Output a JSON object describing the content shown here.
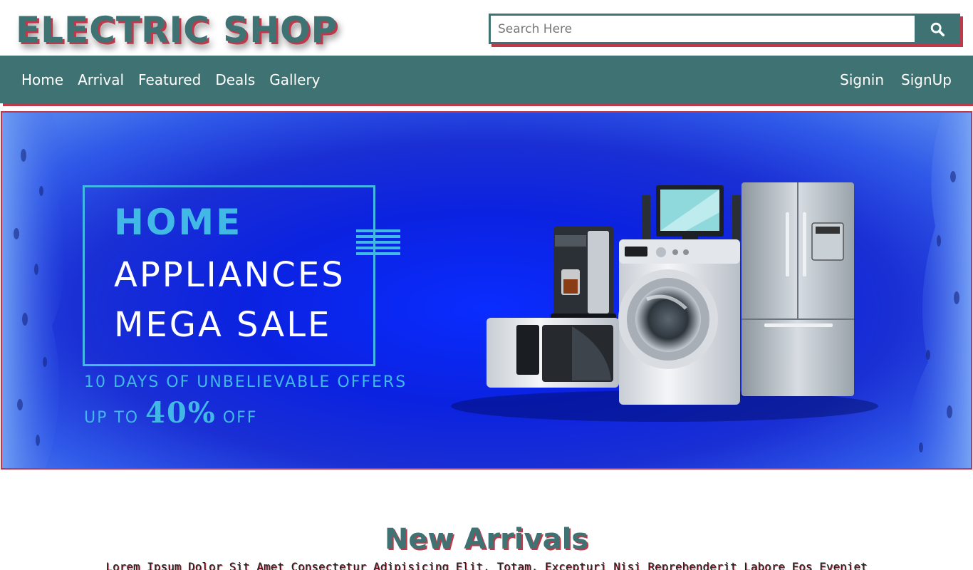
{
  "header": {
    "logo_text": "ELECTRIC SHOP",
    "search": {
      "placeholder": "Search Here",
      "value": "",
      "button_icon": "search-icon"
    }
  },
  "nav": {
    "left_items": [
      {
        "label": "Home"
      },
      {
        "label": "Arrival"
      },
      {
        "label": "Featured"
      },
      {
        "label": "Deals"
      },
      {
        "label": "Gallery"
      }
    ],
    "right_items": [
      {
        "label": "Signin"
      },
      {
        "label": "SignUp"
      }
    ]
  },
  "banner": {
    "line1": "HOME",
    "line2": "APPLIANCES",
    "line3": "MEGA SALE",
    "sub1": "10 DAYS OF UNBELIEVABLE OFFERS",
    "sub2_prefix": "UP TO ",
    "sub2_value": "40%",
    "sub2_suffix": " OFF",
    "appliances": [
      "coffee-machine",
      "microwave",
      "washing-machine",
      "television",
      "refrigerator"
    ]
  },
  "section": {
    "title": "New Arrivals",
    "text": "Lorem Ipsum Dolor Sit Amet Consectetur Adipisicing Elit. Totam, Excepturi Nisi Reprehenderit Labore Eos Eveniet"
  },
  "colors": {
    "primary": "#3f7272",
    "accent": "#c0394b",
    "banner_blue": "#0b22e0",
    "banner_cyan": "#41b8e6"
  }
}
